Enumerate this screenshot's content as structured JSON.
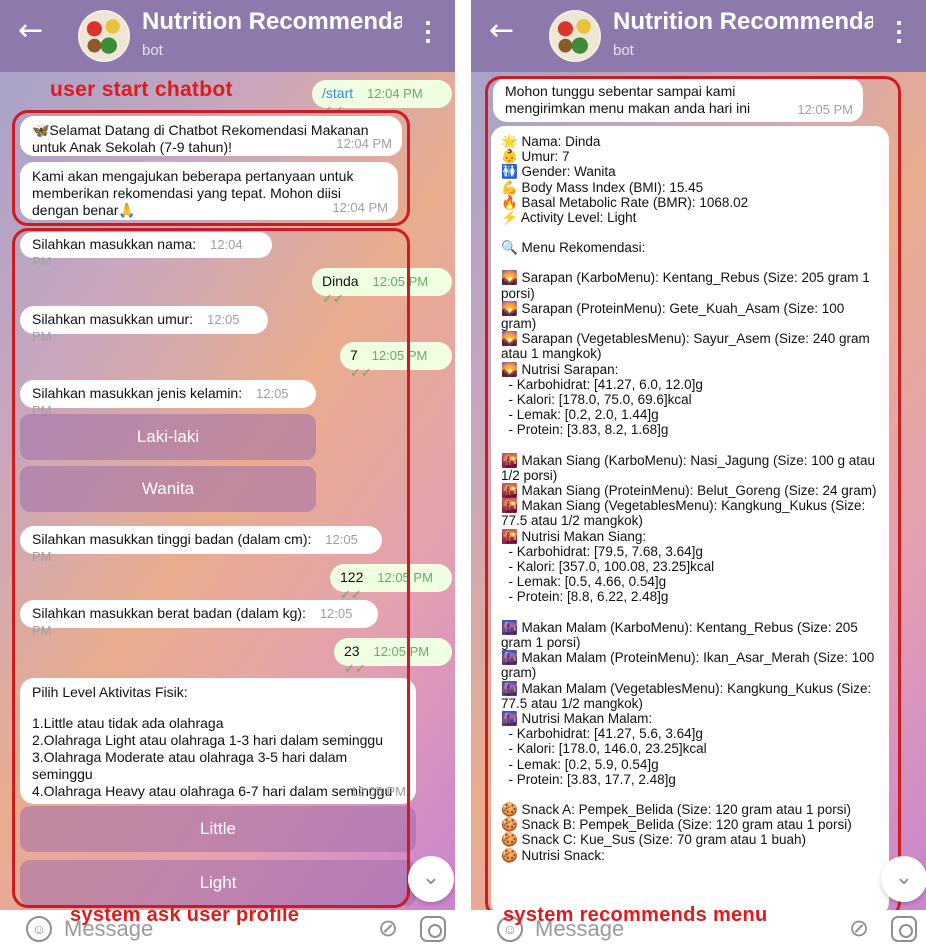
{
  "header": {
    "title": "Nutrition Recommendation fo",
    "subtitle": "bot",
    "back_icon": "arrow-left-icon",
    "menu_icon": "kebab-icon"
  },
  "input": {
    "placeholder": "Message"
  },
  "left": {
    "annotation_top": "user start chatbot",
    "annotation_bottom": "system ask user profile",
    "start_msg": {
      "text": "/start",
      "time": "12:04 PM"
    },
    "welcome": {
      "text": "🦋Selamat Datang di Chatbot Rekomendasi Makanan untuk Anak Sekolah (7-9 tahun)!",
      "time": "12:04 PM"
    },
    "intro": {
      "text": "Kami akan mengajukan beberapa pertanyaan untuk memberikan rekomendasi yang tepat. Mohon diisi dengan benar🙏",
      "time": "12:04 PM"
    },
    "ask_name": {
      "text": "Silahkan masukkan nama:",
      "time": "12:04 PM"
    },
    "ans_name": {
      "text": "Dinda",
      "time": "12:05 PM"
    },
    "ask_age": {
      "text": "Silahkan masukkan umur:",
      "time": "12:05 PM"
    },
    "ans_age": {
      "text": "7",
      "time": "12:05 PM"
    },
    "ask_gender": {
      "text": "Silahkan masukkan jenis kelamin:",
      "time": "12:05 PM"
    },
    "btn_male": "Laki-laki",
    "btn_female": "Wanita",
    "ask_height": {
      "text": "Silahkan masukkan tinggi badan (dalam cm):",
      "time": "12:05 PM"
    },
    "ans_height": {
      "text": "122",
      "time": "12:05 PM"
    },
    "ask_weight": {
      "text": "Silahkan masukkan berat badan (dalam kg):",
      "time": "12:05 PM"
    },
    "ans_weight": {
      "text": "23",
      "time": "12:05 PM"
    },
    "activity": {
      "title": "Pilih Level Aktivitas Fisik:",
      "options": [
        "1.Little atau tidak ada olahraga",
        "2.Olahraga Light atau olahraga 1-3 hari dalam seminggu",
        "3.Olahraga Moderate atau olahraga 3-5 hari dalam seminggu",
        "4.Olahraga Heavy atau olahraga 6-7 hari dalam seminggu"
      ],
      "time": "12:05 PM"
    },
    "btn_little": "Little",
    "btn_light": "Light"
  },
  "right": {
    "annotation_bottom": "system recommends menu",
    "wait_msg": {
      "text": "Mohon tunggu sebentar sampai kami mengirimkan menu makan anda hari ini",
      "time": "12:05 PM"
    },
    "menu_lines": [
      "🌟 Nama: Dinda",
      "👶 Umur: 7",
      "🚻 Gender: Wanita",
      "💪 Body Mass Index (BMI): 15.45",
      "🔥 Basal Metabolic Rate (BMR): 1068.02",
      "⚡ Activity Level: Light",
      "",
      "🔍 Menu Rekomendasi:",
      "",
      "🌄 Sarapan (KarboMenu): Kentang_Rebus (Size: 205 gram 1 porsi)",
      "🌄 Sarapan (ProteinMenu): Gete_Kuah_Asam (Size: 100 gram)",
      "🌄 Sarapan (VegetablesMenu): Sayur_Asem (Size: 240 gram atau 1 mangkok)",
      "🌄 Nutrisi Sarapan:",
      "  - Karbohidrat: [41.27, 6.0, 12.0]g",
      "  - Kalori: [178.0, 75.0, 69.6]kcal",
      "  - Lemak: [0.2, 2.0, 1.44]g",
      "  - Protein: [3.83, 8.2, 1.68]g",
      "",
      "🌇 Makan Siang (KarboMenu): Nasi_Jagung (Size: 100 g atau 1/2 porsi)",
      "🌇 Makan Siang (ProteinMenu): Belut_Goreng (Size: 24 gram)",
      "🌇 Makan Siang (VegetablesMenu): Kangkung_Kukus (Size: 77.5 atau 1/2 mangkok)",
      "🌇 Nutrisi Makan Siang:",
      "  - Karbohidrat: [79.5, 7.68, 3.64]g",
      "  - Kalori: [357.0, 100.08, 23.25]kcal",
      "  - Lemak: [0.5, 4.66, 0.54]g",
      "  - Protein: [8.8, 6.22, 2.48]g",
      "",
      "🌆 Makan Malam (KarboMenu): Kentang_Rebus (Size: 205 gram 1 porsi)",
      "🌆 Makan Malam (ProteinMenu): Ikan_Asar_Merah (Size: 100 gram)",
      "🌆 Makan Malam (VegetablesMenu): Kangkung_Kukus (Size: 77.5 atau 1/2 mangkok)",
      "🌆 Nutrisi Makan Malam:",
      "  - Karbohidrat: [41.27, 5.6, 3.64]g",
      "  - Kalori: [178.0, 146.0, 23.25]kcal",
      "  - Lemak: [0.2, 5.9, 0.54]g",
      "  - Protein: [3.83, 17.7, 2.48]g",
      "",
      "🍪 Snack A: Pempek_Belida (Size: 120 gram atau 1 porsi)",
      "🍪 Snack B: Pempek_Belida (Size: 120 gram atau 1 porsi)",
      "🍪 Snack C: Kue_Sus (Size: 70 gram atau 1 buah)",
      "🍪 Nutrisi Snack:"
    ]
  },
  "colors": {
    "header": "#8e79ad",
    "annotation": "#e01b1b",
    "check": "#6aa96b"
  }
}
